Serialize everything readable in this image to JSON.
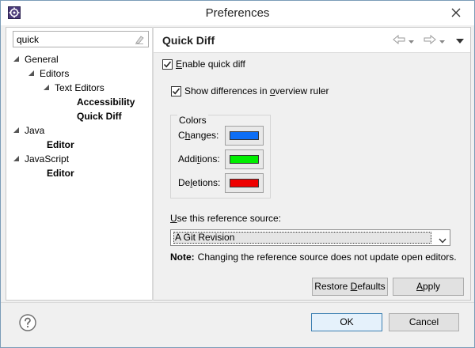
{
  "window": {
    "title": "Preferences"
  },
  "filter": {
    "value": "quick"
  },
  "tree": [
    {
      "label": "General",
      "level": 0,
      "expanded": true
    },
    {
      "label": "Editors",
      "level": 1,
      "expanded": true
    },
    {
      "label": "Text Editors",
      "level": 2,
      "expanded": true
    },
    {
      "label": "Accessibility",
      "level": 3,
      "bold": true
    },
    {
      "label": "Quick Diff",
      "level": 3,
      "bold": true
    },
    {
      "label": "Java",
      "level": 0,
      "expanded": true
    },
    {
      "label": "Editor",
      "level": 1,
      "bold": true
    },
    {
      "label": "JavaScript",
      "level": 0,
      "expanded": true
    },
    {
      "label": "Editor",
      "level": 1,
      "bold": true
    }
  ],
  "page": {
    "title": "Quick Diff",
    "enable_quick_diff": {
      "label_pre": "",
      "label_u": "E",
      "label_post": "nable quick diff",
      "checked": true
    },
    "show_differences": {
      "label_pre": "Show differences in ",
      "label_u": "o",
      "label_post": "verview ruler",
      "checked": true
    },
    "colors_group": {
      "title": "Colors",
      "items": [
        {
          "label_pre": "C",
          "label_u": "h",
          "label_post": "anges:",
          "color": "#0d6ef5"
        },
        {
          "label_pre": "Addi",
          "label_u": "t",
          "label_post": "ions:",
          "color": "#00ee00"
        },
        {
          "label_pre": "De",
          "label_u": "l",
          "label_post": "etions:",
          "color": "#ee0000"
        }
      ]
    },
    "reference_source": {
      "label_pre": "",
      "label_u": "U",
      "label_post": "se this reference source:",
      "selected": "A Git Revision"
    },
    "note": {
      "prefix": "Note:",
      "text": "Changing the reference source does not update open editors."
    },
    "restore_defaults": {
      "label_pre": "Restore ",
      "label_u": "D",
      "label_post": "efaults"
    },
    "apply": {
      "label_pre": "",
      "label_u": "A",
      "label_post": "pply"
    }
  },
  "footer": {
    "ok_label": "OK",
    "cancel_label": "Cancel"
  },
  "colors": {
    "accent": "#3c7fb1",
    "title_bg": "#ffffff"
  }
}
